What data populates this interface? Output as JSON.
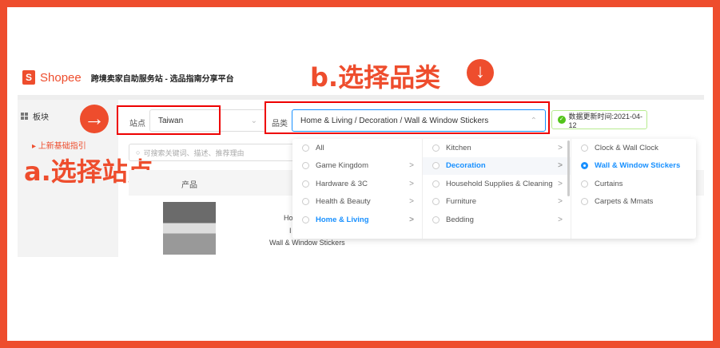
{
  "header": {
    "logo": "Shopee",
    "subtitle": "跨境卖家自助服务站 - 选品指南分享平台"
  },
  "sidebar": {
    "item": "板块",
    "sub_item": "上新基础指引"
  },
  "annotations": {
    "a": "a.选择站点",
    "b": "b.选择品类"
  },
  "filters": {
    "site_label": "站点",
    "site_value": "Taiwan",
    "category_label": "品类",
    "category_value": "Home & Living / Decoration / Wall & Window Stickers",
    "update_time": "数据更新时间:2021-04-12"
  },
  "search": {
    "placeholder": "可搜索关键词、描述、推荐理由"
  },
  "table": {
    "header_product": "产品",
    "row_name_1": "Ho",
    "row_name_2": "I",
    "row_name_3": "Wall & Window Stickers"
  },
  "dropdown": {
    "col1": [
      {
        "label": "All",
        "chev": ""
      },
      {
        "label": "Game Kingdom",
        "chev": ">"
      },
      {
        "label": "Hardware & 3C",
        "chev": ">"
      },
      {
        "label": "Health & Beauty",
        "chev": ">"
      },
      {
        "label": "Home & Living",
        "chev": ">"
      }
    ],
    "col2": [
      {
        "label": "Kitchen",
        "chev": ">"
      },
      {
        "label": "Decoration",
        "chev": ">"
      },
      {
        "label": "Household Supplies & Cleaning",
        "chev": ">"
      },
      {
        "label": "Furniture",
        "chev": ">"
      },
      {
        "label": "Bedding",
        "chev": ">"
      }
    ],
    "col3": [
      {
        "label": "Clock & Wall Clock"
      },
      {
        "label": "Wall & Window Stickers"
      },
      {
        "label": "Curtains"
      },
      {
        "label": "Carpets & Mmats"
      }
    ]
  }
}
